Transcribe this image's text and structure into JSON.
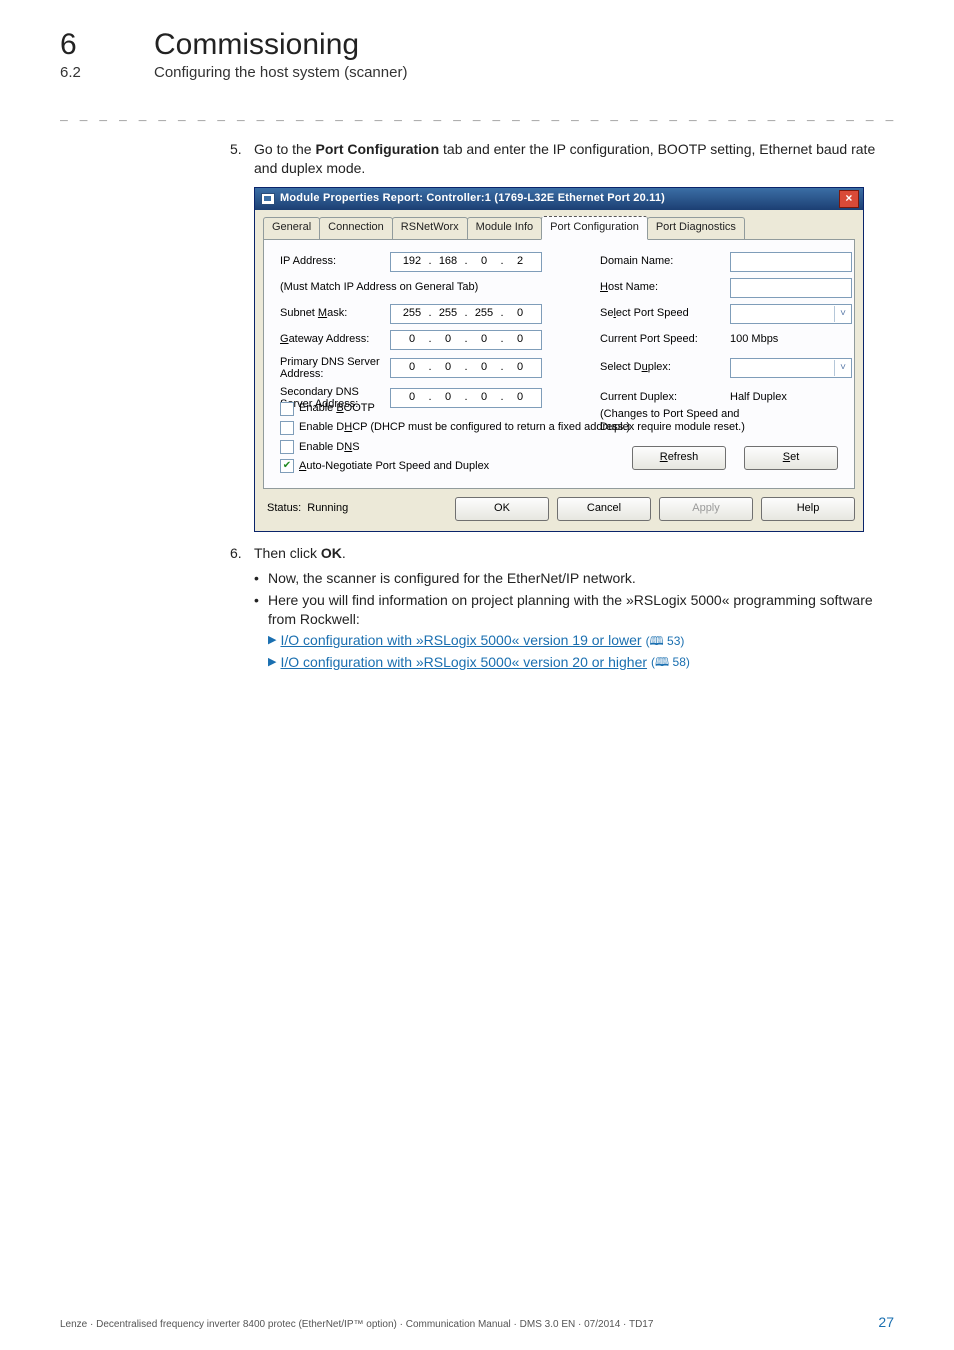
{
  "header": {
    "chapter_number": "6",
    "chapter_title": "Commissioning",
    "section_number": "6.2",
    "section_title": "Configuring the host system (scanner)",
    "rule": "_ _ _ _ _ _ _ _ _ _ _ _ _ _ _ _ _ _ _ _ _ _ _ _ _ _ _ _ _ _ _ _ _ _ _ _ _ _ _ _ _ _ _ _ _ _ _ _ _ _ _ _ _ _ _ _ _ _ _ _ _ _ _ _"
  },
  "step5": {
    "num": "5.",
    "text_prefix": "Go to the ",
    "bold_part": "Port Configuration",
    "text_suffix": " tab and enter the IP configuration, BOOTP setting, Ethernet baud rate and duplex mode."
  },
  "dialog": {
    "title": "Module Properties Report: Controller:1 (1769-L32E Ethernet Port 20.11)",
    "tabs": {
      "general": "General",
      "connection": "Connection",
      "rsnetworx": "RSNetWorx",
      "module_info": "Module Info",
      "port_config": "Port Configuration",
      "port_diag": "Port Diagnostics"
    },
    "labels": {
      "ip_address": "IP Address:",
      "must_match": "(Must Match IP Address on General Tab)",
      "subnet_mask_pre": "Subnet ",
      "subnet_mask_und": "M",
      "subnet_mask_post": "ask:",
      "gateway_und": "G",
      "gateway_post": "ateway Address:",
      "primary_dns": "Primary DNS Server Address:",
      "secondary_dns": "Secondary DNS Server Address:",
      "domain_name": "Domain Name:",
      "host_name_und": "H",
      "host_name_post": "ost Name:",
      "select_port_speed_pre": "Se",
      "select_port_speed_und": "l",
      "select_port_speed_post": "ect Port Speed",
      "current_port_speed": "Current Port Speed:",
      "select_duplex_pre": "Select D",
      "select_duplex_und": "u",
      "select_duplex_post": "plex:",
      "current_duplex": "Current Duplex:",
      "changes_note1": "(Changes to Port Speed and",
      "changes_note2": "Duplex require module reset.)"
    },
    "values": {
      "ip": [
        "192",
        "168",
        "0",
        "2"
      ],
      "subnet": [
        "255",
        "255",
        "255",
        "0"
      ],
      "gateway": [
        "0",
        "0",
        "0",
        "0"
      ],
      "primary_dns": [
        "0",
        "0",
        "0",
        "0"
      ],
      "secondary_dns": [
        "0",
        "0",
        "0",
        "0"
      ],
      "current_port_speed": "100 Mbps",
      "current_duplex": "Half Duplex"
    },
    "checkboxes": {
      "bootp_pre": "Enable ",
      "bootp_und": "B",
      "bootp_post": "OOTP",
      "dhcp_pre": "Enable D",
      "dhcp_und": "H",
      "dhcp_post": "CP  (DHCP must be configured to return a fixed address.)",
      "dns_pre": "Enable D",
      "dns_und": "N",
      "dns_post": "S",
      "autoneg_und": "A",
      "autoneg_post": "uto-Negotiate Port Speed and Duplex"
    },
    "buttons": {
      "refresh_und": "R",
      "refresh_post": "efresh",
      "set_und": "S",
      "set_post": "et",
      "ok": "OK",
      "cancel": "Cancel",
      "apply": "Apply",
      "help": "Help"
    },
    "status_label": "Status:",
    "status_value": "Running"
  },
  "step6": {
    "num": "6.",
    "text_prefix": "Then click ",
    "bold_part": "OK",
    "text_suffix": "."
  },
  "bullets": {
    "b1": "Now, the scanner is configured for the EtherNet/IP network.",
    "b2": "Here you will find information on project planning with the »RSLogix 5000« programming software from Rockwell:"
  },
  "links": {
    "l1_text": "I/O configuration with »RSLogix 5000« version 19 or lower",
    "l1_ref": "53)",
    "l2_text": "I/O configuration with »RSLogix 5000« version 20 or higher",
    "l2_ref": "58)"
  },
  "footer": {
    "left": "Lenze · Decentralised frequency inverter 8400 protec (EtherNet/IP™ option) · Communication Manual · DMS 3.0 EN · 07/2014 · TD17",
    "page": "27"
  }
}
